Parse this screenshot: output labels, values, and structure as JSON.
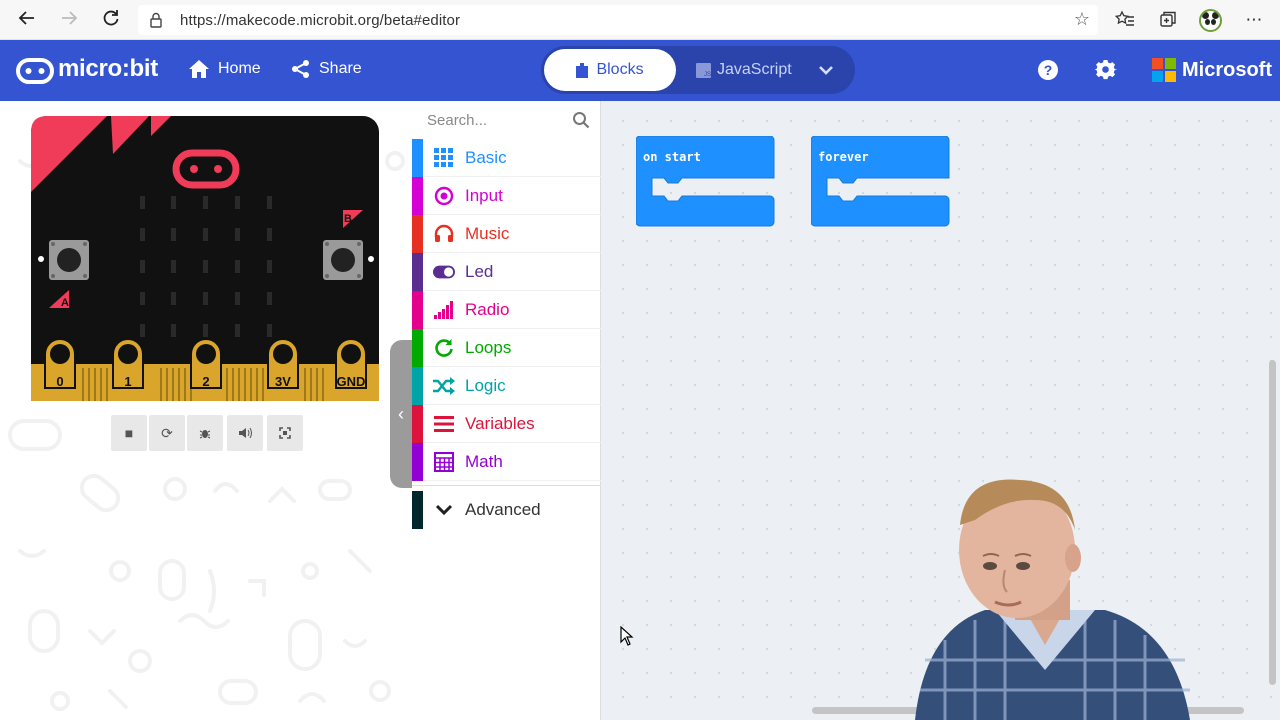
{
  "browser": {
    "url": "https://makecode.microbit.org/beta#editor",
    "back_icon": "back-arrow-icon",
    "forward_icon": "forward-arrow-icon",
    "refresh_icon": "refresh-icon"
  },
  "header": {
    "logo_text": "micro:bit",
    "home_label": "Home",
    "share_label": "Share",
    "blocks_label": "Blocks",
    "javascript_label": "JavaScript",
    "microsoft_label": "Microsoft",
    "brand_color": "#3454d1"
  },
  "simulator": {
    "button_a": "A",
    "button_b": "B",
    "pins": [
      "0",
      "1",
      "2",
      "3V",
      "GND"
    ],
    "controls": [
      "stop",
      "restart",
      "debug",
      "mute",
      "fullscreen"
    ]
  },
  "toolbox": {
    "search_placeholder": "Search...",
    "categories": [
      {
        "label": "Basic",
        "color": "#1e90ff",
        "icon": "grid-icon"
      },
      {
        "label": "Input",
        "color": "#d400d4",
        "icon": "target-icon"
      },
      {
        "label": "Music",
        "color": "#e63022",
        "icon": "headphones-icon"
      },
      {
        "label": "Led",
        "color": "#5c2d91",
        "icon": "toggle-icon"
      },
      {
        "label": "Radio",
        "color": "#e3008c",
        "icon": "signal-icon"
      },
      {
        "label": "Loops",
        "color": "#00aa00",
        "icon": "loop-icon"
      },
      {
        "label": "Logic",
        "color": "#00a4a6",
        "icon": "shuffle-icon"
      },
      {
        "label": "Variables",
        "color": "#dc143c",
        "icon": "lines-icon"
      },
      {
        "label": "Math",
        "color": "#9400d3",
        "icon": "calculator-icon"
      }
    ],
    "advanced_label": "Advanced",
    "advanced_color": "#00272b"
  },
  "workspace": {
    "blocks": [
      {
        "label": "on start",
        "color": "#1e90ff"
      },
      {
        "label": "forever",
        "color": "#1e90ff"
      }
    ]
  }
}
